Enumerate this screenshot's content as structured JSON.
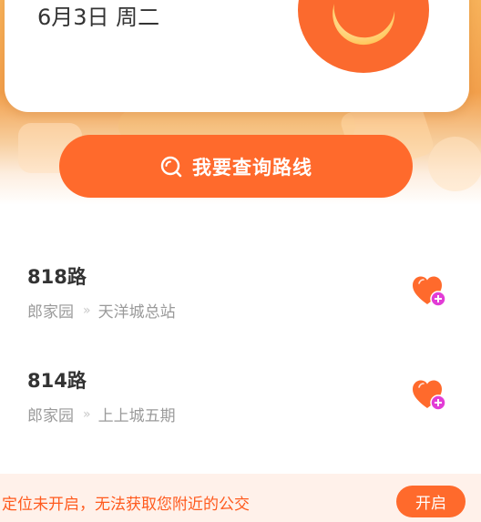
{
  "header": {
    "date": "6月3日 周二",
    "weather_icon": "moon-icon"
  },
  "search": {
    "button_label": "我要查询路线",
    "icon": "search-icon"
  },
  "routes": [
    {
      "name": "818路",
      "from": "郎家园",
      "to": "天洋城总站",
      "arrow": "»"
    },
    {
      "name": "814路",
      "from": "郎家园",
      "to": "上上城五期",
      "arrow": "»"
    }
  ],
  "location_notice": {
    "text": "定位未开启，无法获取您附近的公交",
    "button_label": "开启"
  },
  "colors": {
    "accent": "#ff6a2c",
    "notice_bg": "#fff1ea",
    "notice_text": "#ff5a1e"
  }
}
